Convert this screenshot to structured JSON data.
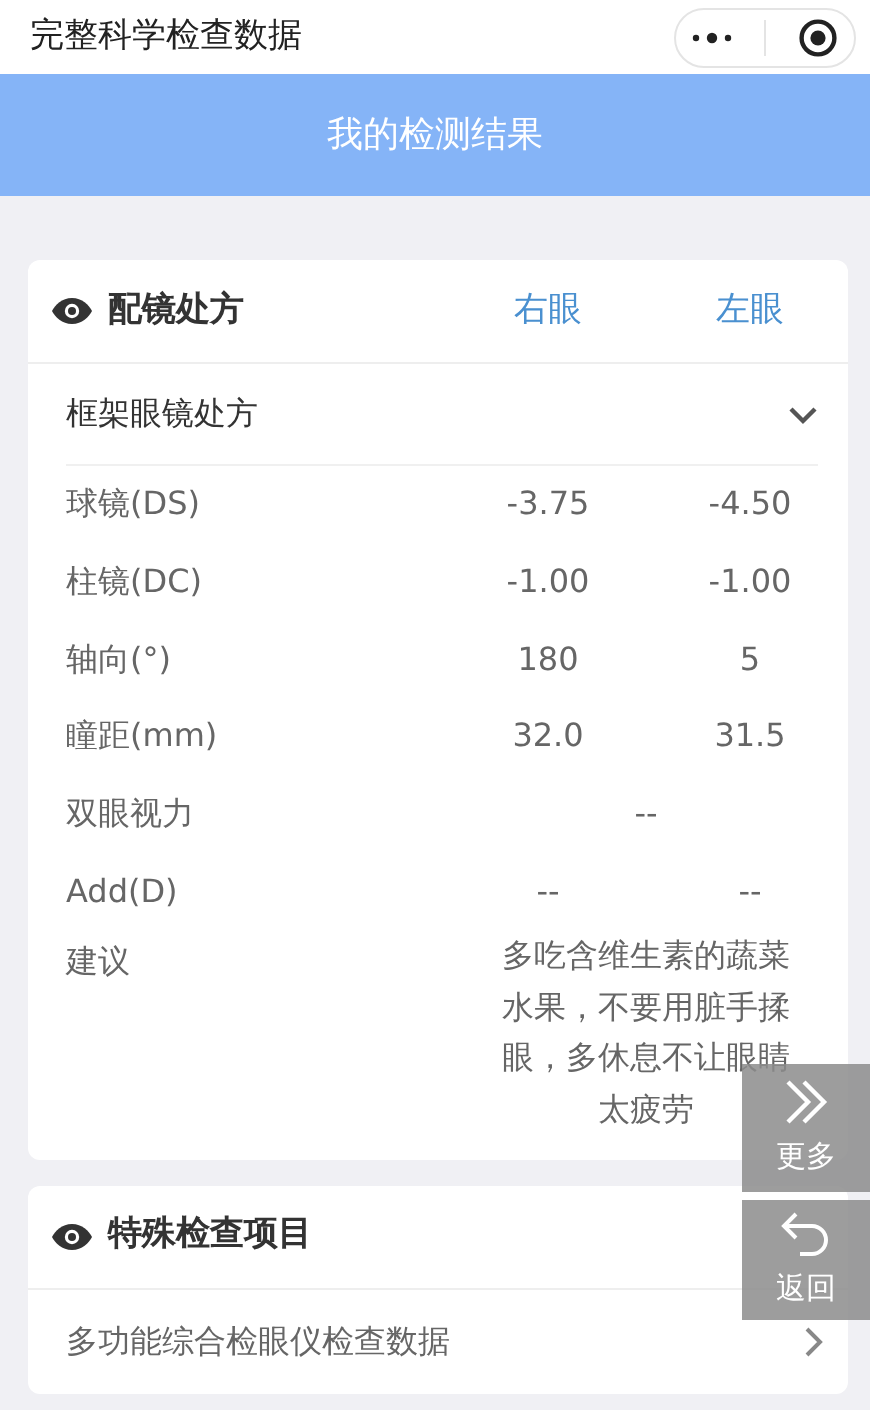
{
  "top_bar": {
    "title": "完整科学检查数据"
  },
  "header": {
    "title": "我的检测结果"
  },
  "prescription_card": {
    "title": "配镜处方",
    "columns": [
      "右眼",
      "左眼"
    ],
    "section": {
      "title": "框架眼镜处方",
      "expanded": true
    },
    "rows": [
      {
        "label": "球镜(DS)",
        "values": [
          "-3.75",
          "-4.50"
        ]
      },
      {
        "label": "柱镜(DC)",
        "values": [
          "-1.00",
          "-1.00"
        ]
      },
      {
        "label": "轴向(°)",
        "values": [
          "180",
          "5"
        ]
      },
      {
        "label": "瞳距(mm)",
        "values": [
          "32.0",
          "31.5"
        ]
      },
      {
        "label": "双眼视力",
        "values": [
          "--"
        ]
      },
      {
        "label": "Add(D)",
        "values": [
          "--",
          "--"
        ]
      },
      {
        "label": "建议",
        "values": [
          "多吃含维生素的蔬菜水果，不要用脏手揉眼，多休息不让眼睛太疲劳"
        ]
      }
    ]
  },
  "special_card": {
    "title": "特殊检查项目",
    "items": [
      {
        "label": "多功能综合检眼仪检查数据"
      }
    ]
  },
  "float_buttons": [
    {
      "kind": "more",
      "label": "更多"
    },
    {
      "kind": "back",
      "label": "返回"
    }
  ]
}
